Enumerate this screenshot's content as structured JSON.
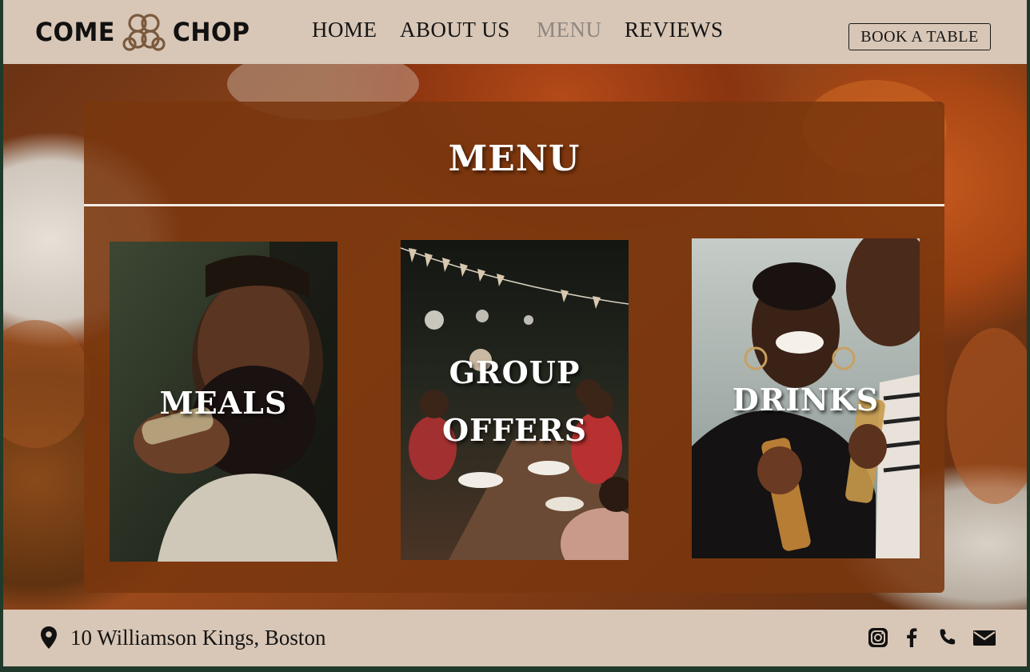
{
  "brand": {
    "name_left": "COME",
    "name_right": "CHOP",
    "logo_icon": "knot-icon"
  },
  "nav": {
    "items": [
      {
        "label": "HOME",
        "active": false
      },
      {
        "label": "ABOUT US",
        "active": false
      },
      {
        "label": "MENU",
        "active": true
      },
      {
        "label": "REVIEWS",
        "active": false
      }
    ],
    "cta_label": "BOOK A TABLE"
  },
  "menu": {
    "title": "MENU",
    "cards": [
      {
        "label_lines": [
          "MEALS"
        ],
        "photo": "man-eating-photo"
      },
      {
        "label_lines": [
          "GROUP",
          "OFFERS"
        ],
        "photo": "group-dinner-photo"
      },
      {
        "label_lines": [
          "DRINKS"
        ],
        "photo": "friends-drinking-photo"
      }
    ]
  },
  "footer": {
    "address": "10 Williamson Kings, Boston",
    "address_icon": "location-pin-icon",
    "social_icons": [
      "instagram-icon",
      "facebook-icon",
      "phone-icon",
      "mail-icon"
    ]
  },
  "colors": {
    "header_bg": "#d8c6b6",
    "panel_bg": "#7a370e",
    "active_nav": "#8f8781",
    "text": "#141414"
  }
}
